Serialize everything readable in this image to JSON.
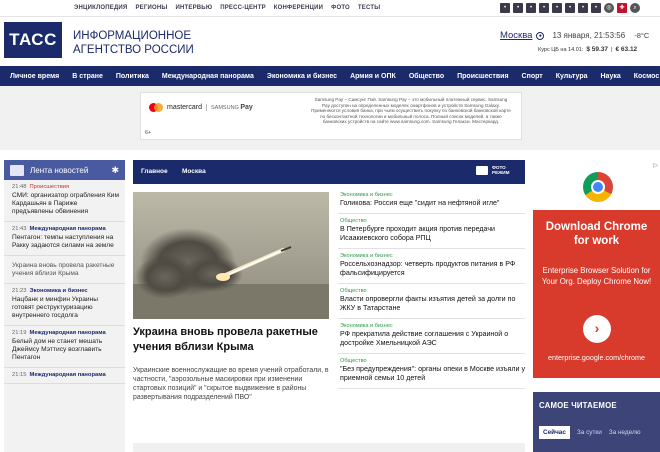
{
  "top_links": [
    "ЭНЦИКЛОПЕДИЯ",
    "РЕГИОНЫ",
    "ИНТЕРВЬЮ",
    "ПРЕСС-ЦЕНТР",
    "КОНФЕРЕНЦИИ",
    "ФОТО",
    "ТЕСТЫ"
  ],
  "header": {
    "logo": "ТАСС",
    "agency_line1": "ИНФОРМАЦИОННОЕ",
    "agency_line2": "АГЕНТСТВО РОССИИ",
    "city": "Москва",
    "datetime": "13 января, 21:53:56",
    "temperature": "-8°C",
    "rates_label": "Курс ЦБ на 14.01:",
    "usd": "$ 59.37",
    "eur": "€ 63.12"
  },
  "nav": [
    "Личное время",
    "В стране",
    "Политика",
    "Международная панорама",
    "Экономика и бизнес",
    "Армия и ОПК",
    "Общество",
    "Происшествия",
    "Спорт",
    "Культура",
    "Наука",
    "Космос"
  ],
  "ad_banner": {
    "brand1": "mastercard",
    "brand2": "SAMSUNG",
    "brand2b": "Pay",
    "text": "Samsung Pay – Самсунг Пэй. Samsung Pay – это мобильный платежный сервис. Samsung Pay доступен на определенных моделях смартфонов и устройств Samsung Galaxy. Применяются условия банка, при чьем осуществить покупку по банковской банковской карте по бесконтактной технологии и мобильный полоса. Полный список моделей, а также банковских устройств на сайте www.samsung.com. Samsung Гелакси. Мастеркард.",
    "age": "6+"
  },
  "feed": {
    "title": "Лента новостей",
    "items": [
      {
        "time": "21:48",
        "category": "Происшествия",
        "text": "СМИ: организатор ограбления Ким Кардашьян в Париже предъявлены обвинения"
      },
      {
        "time": "21:43",
        "category": "Международная панорама",
        "text": "Пентагон: темпы наступления на Ракку задаются силами на земле"
      },
      {
        "time": "",
        "category": "",
        "text": "Украина вновь провела ракетные учения вблизи Крыма"
      },
      {
        "time": "21:23",
        "category": "Экономика и бизнес",
        "text": "Нацбанк и минфин Украины готовят реструктуризацию внутреннего госдолга"
      },
      {
        "time": "21:19",
        "category": "Международная панорама",
        "text": "Белый дом не станет мешать Джеймсу Мэттису возглавить Пентагон"
      },
      {
        "time": "21:15",
        "category": "Международная панорама",
        "text": ""
      }
    ]
  },
  "main": {
    "tab1": "Главное",
    "tab2": "Москва",
    "photo_mode_line1": "ФОТО",
    "photo_mode_line2": "РЕЖИМ",
    "headline": "Украина вновь провела ракетные учения вблизи Крыма",
    "lead": "Украинские военнослужащие во время учений отработали, в частности, \"аэрозольные маскировки при изменении стартовых позиций\" и \"скрытое выдвижение в районы развертывания подразделений ПВО\""
  },
  "news": [
    {
      "category": "Экономика и бизнес",
      "title": "Голикова: Россия еще \"сидит на нефтяной игле\""
    },
    {
      "category": "Общество",
      "title": "В Петербурге проходит акция против передачи Исаакиевского собора РПЦ"
    },
    {
      "category": "Экономика и бизнес",
      "title": "Россельхознадзор: четверть продуктов питания в РФ фальсифицируется"
    },
    {
      "category": "Общество",
      "title": "Власти опровергли факты изъятия детей за долги по ЖКУ в Татарстане"
    },
    {
      "category": "Экономика и бизнес",
      "title": "РФ прекратила действие соглашения с Украиной о достройке Хмельницкой АЭС"
    },
    {
      "category": "Общество",
      "title": "\"Без предупреждения\": органы опеки в Москве изъяли у приемной семьи 10 детей"
    }
  ],
  "chrome_ad": {
    "heading": "Download Chrome for work",
    "sub": "Enterprise Browser Solution for Your Org. Deploy Chrome Now!",
    "button": "›",
    "url": "enterprise.google.com/chrome",
    "ad_mark": "▷"
  },
  "popular": {
    "title": "САМОЕ ЧИТАЕМОЕ",
    "tabs": [
      "Сейчас",
      "За сутки",
      "За неделю"
    ]
  },
  "colors": {
    "brand": "#1b2a6b",
    "feed_head": "#4a5aa0",
    "chrome_red": "#d83a2c",
    "category_green": "#2e9a4a"
  }
}
